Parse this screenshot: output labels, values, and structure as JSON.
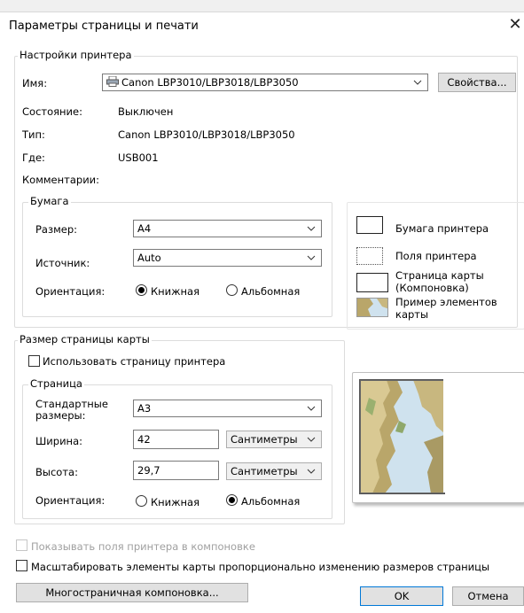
{
  "window": {
    "title": "Параметры страницы и печати"
  },
  "printer": {
    "group_label": "Настройки принтера",
    "name_label": "Имя:",
    "name_value": "Canon LBP3010/LBP3018/LBP3050",
    "properties_button": "Свойства...",
    "status_label": "Состояние:",
    "status_value": "Выключен",
    "type_label": "Тип:",
    "type_value": "Canon LBP3010/LBP3018/LBP3050",
    "where_label": "Где:",
    "where_value": "USB001",
    "comment_label": "Комментарии:",
    "paper": {
      "group_label": "Бумага",
      "size_label": "Размер:",
      "size_value": "A4",
      "source_label": "Источник:",
      "source_value": "Auto",
      "orientation_label": "Ориентация:",
      "portrait": "Книжная",
      "landscape": "Альбомная",
      "orientation_selected": "portrait"
    }
  },
  "legend_items": {
    "printer_paper": "Бумага принтера",
    "printer_margins": "Поля принтера",
    "map_page": "Страница карты\n(Компоновка)",
    "map_sample": "Пример элементов\nкарты"
  },
  "map_page_size": {
    "group_label": "Размер страницы карты",
    "use_printer_page": "Использовать страницу принтера",
    "use_printer_page_checked": false,
    "page": {
      "group_label": "Страница",
      "standard_label": "Стандартные\nразмеры:",
      "standard_value": "A3",
      "width_label": "Ширина:",
      "width_value": "42",
      "width_unit": "Сантиметры",
      "height_label": "Высота:",
      "height_value": "29,7",
      "height_unit": "Сантиметры",
      "orientation_label": "Ориентация:",
      "portrait": "Книжная",
      "landscape": "Альбомная",
      "orientation_selected": "landscape"
    }
  },
  "options": {
    "show_printer_margins": "Показывать поля принтера в компоновке",
    "show_printer_margins_checked": false,
    "show_printer_margins_enabled": false,
    "scale_elements": "Масштабировать элементы карты пропорционально изменению размеров страницы",
    "scale_elements_checked": false
  },
  "buttons": {
    "multipage": "Многостраничная компоновка...",
    "ok": "OK",
    "cancel": "Отмена"
  },
  "colors": {
    "accent": "#0078d7",
    "map_water": "#cfe2ee",
    "map_land": "#b9a66a"
  }
}
